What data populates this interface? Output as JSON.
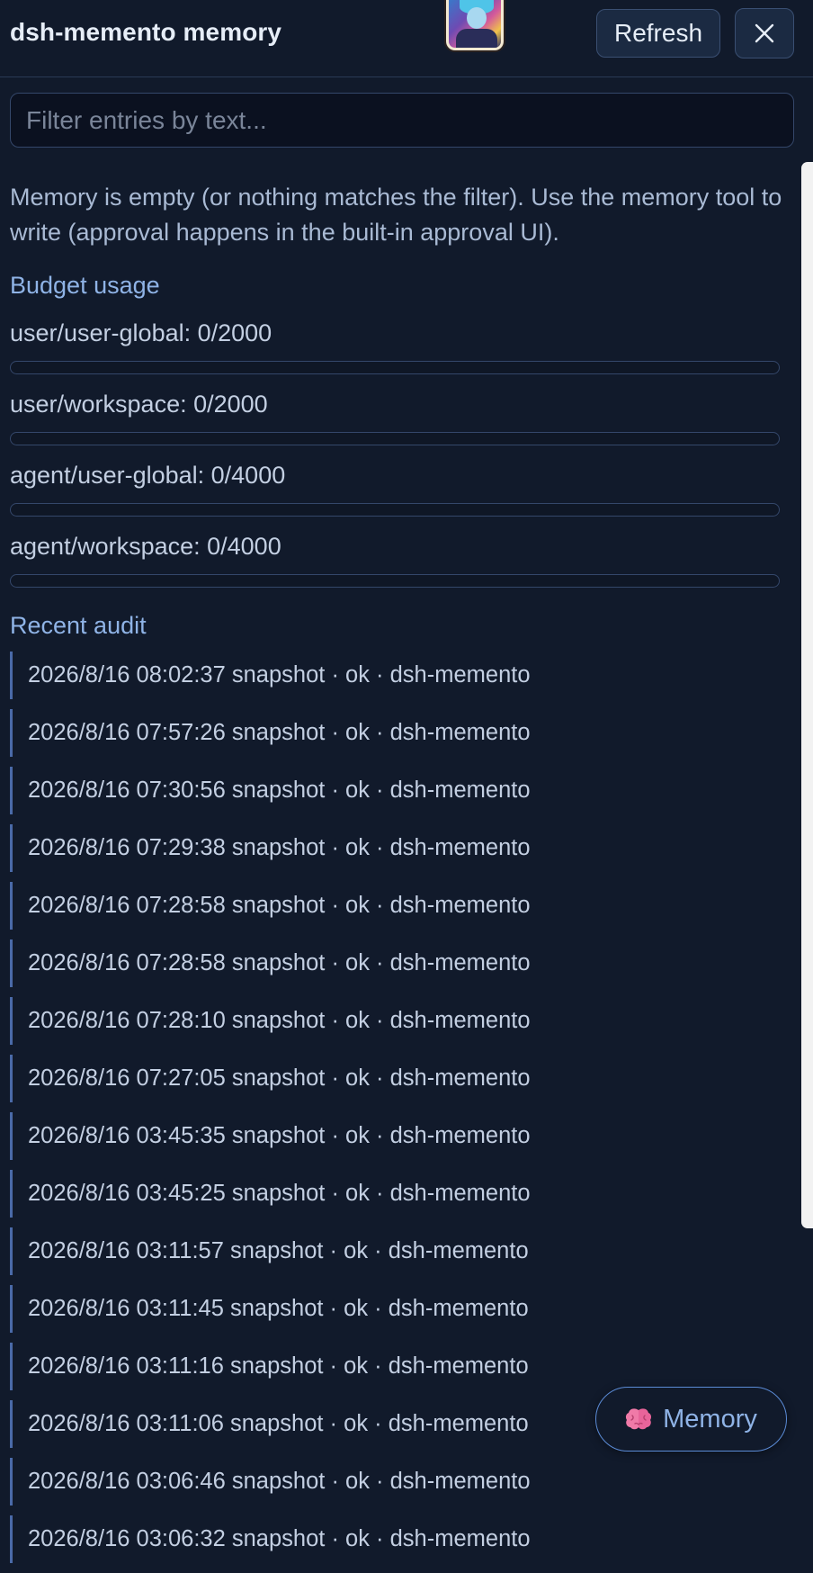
{
  "header": {
    "title": "dsh-memento memory",
    "refresh_label": "Refresh",
    "close_icon": "close-icon"
  },
  "filter": {
    "placeholder": "Filter entries by text...",
    "value": ""
  },
  "empty_message": "Memory is empty (or nothing matches the filter). Use the memory tool to write (approval happens in the built-in approval UI).",
  "budget": {
    "title": "Budget usage",
    "items": [
      {
        "label": "user/user-global: 0/2000",
        "used": 0,
        "limit": 2000
      },
      {
        "label": "user/workspace: 0/2000",
        "used": 0,
        "limit": 2000
      },
      {
        "label": "agent/user-global: 0/4000",
        "used": 0,
        "limit": 4000
      },
      {
        "label": "agent/workspace: 0/4000",
        "used": 0,
        "limit": 4000
      }
    ]
  },
  "audit": {
    "title": "Recent audit",
    "entries": [
      "2026/8/16 08:02:37 snapshot · ok · dsh-memento",
      "2026/8/16 07:57:26 snapshot · ok · dsh-memento",
      "2026/8/16 07:30:56 snapshot · ok · dsh-memento",
      "2026/8/16 07:29:38 snapshot · ok · dsh-memento",
      "2026/8/16 07:28:58 snapshot · ok · dsh-memento",
      "2026/8/16 07:28:58 snapshot · ok · dsh-memento",
      "2026/8/16 07:28:10 snapshot · ok · dsh-memento",
      "2026/8/16 07:27:05 snapshot · ok · dsh-memento",
      "2026/8/16 03:45:35 snapshot · ok · dsh-memento",
      "2026/8/16 03:45:25 snapshot · ok · dsh-memento",
      "2026/8/16 03:11:57 snapshot · ok · dsh-memento",
      "2026/8/16 03:11:45 snapshot · ok · dsh-memento",
      "2026/8/16 03:11:16 snapshot · ok · dsh-memento",
      "2026/8/16 03:11:06 snapshot · ok · dsh-memento",
      "2026/8/16 03:06:46 snapshot · ok · dsh-memento",
      "2026/8/16 03:06:32 snapshot · ok · dsh-memento"
    ]
  },
  "fab": {
    "label": "Memory",
    "icon": "brain-icon"
  },
  "colors": {
    "background": "#111a2b",
    "accent": "#8fb3e6",
    "border": "#34476a"
  }
}
